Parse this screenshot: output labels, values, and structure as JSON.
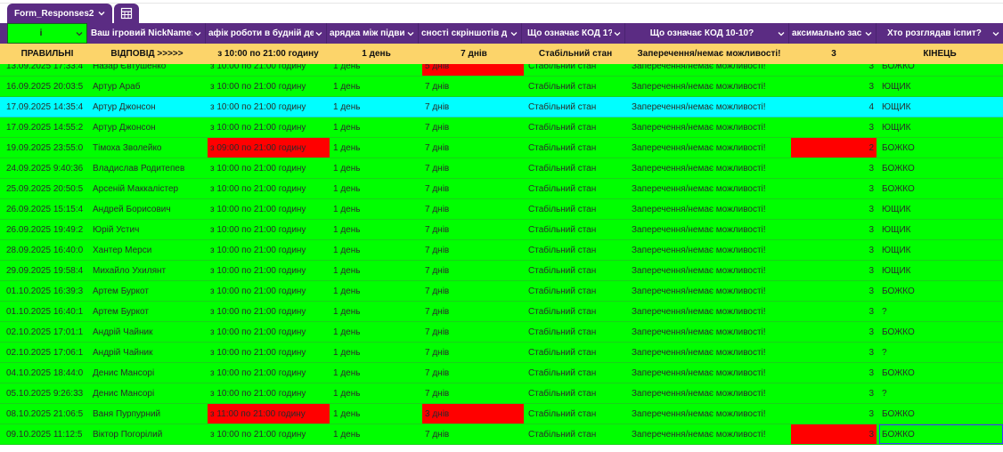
{
  "sheet_tab": {
    "label": "Form_Responses2"
  },
  "filter_header": {
    "first_cell": "і",
    "columns": [
      "Ваш ігровий NickName:",
      "афік роботи в будній ден",
      "арядка між підвищ",
      "сності скріншотів д",
      "Що означає КОД 1?",
      "Що означає КОД 10-10?",
      "аксимально зас",
      "Хто розглядав іспит?"
    ]
  },
  "answer_key": {
    "label_1": "ПРАВИЛЬНІ",
    "label_2": "ВІДПОВІД >>>>>",
    "schedule": "з 10:00 по 21:00 годину",
    "order": "1 день",
    "screens": "7 днів",
    "code1": "Стабільний стан",
    "code1010": "Заперечення/немає можливості!",
    "max": "3",
    "reviewer": "КІНЕЦЬ"
  },
  "rows": [
    {
      "ts": "13.09.2025 17:33:4",
      "nick": "Назар Євтушенко",
      "schedule": "з 10:00 по 21:00 годину",
      "order": "1 день",
      "screens": "5 днів",
      "code1": "Стабільний стан",
      "code1010": "Заперечення/немає можливості!",
      "max": "3",
      "reviewer": "БОЖКО",
      "red_screens": true
    },
    {
      "ts": "16.09.2025 20:03:5",
      "nick": "Артур Араб",
      "schedule": "з 10:00 по 21:00 годину",
      "order": "1 день",
      "screens": "7 днів",
      "code1": "Стабільний стан",
      "code1010": "Заперечення/немає можливості!",
      "max": "3",
      "reviewer": "ЮЩИК"
    },
    {
      "ts": "17.09.2025 14:35:4",
      "nick": "Артур Джонсон",
      "schedule": "з 10:00 по 21:00 годину",
      "order": "1 день",
      "screens": "7 днів",
      "code1": "Стабільний стан",
      "code1010": "Заперечення/немає можливості!",
      "max": "4",
      "reviewer": "ЮЩИК",
      "cyan": true
    },
    {
      "ts": "17.09.2025 14:55:2",
      "nick": "Артур Джонсон",
      "schedule": "з 10:00 по 21:00 годину",
      "order": "1 день",
      "screens": "7 днів",
      "code1": "Стабільний стан",
      "code1010": "Заперечення/немає можливості!",
      "max": "3",
      "reviewer": "ЮЩИК"
    },
    {
      "ts": "19.09.2025 23:55:0",
      "nick": "Тімоха Зволейко",
      "schedule": "з 09:00 по 21:00 годину",
      "order": "1 день",
      "screens": "7 днів",
      "code1": "Стабільний стан",
      "code1010": "Заперечення/немає можливості!",
      "max": "2",
      "reviewer": "БОЖКО",
      "red_schedule": true,
      "red_max": true
    },
    {
      "ts": "24.09.2025 9:40:36",
      "nick": "Владислав Родитепев",
      "schedule": "з 10:00 по 21:00 годину",
      "order": "1 день",
      "screens": "7 днів",
      "code1": "Стабільний стан",
      "code1010": "Заперечення/немає можливості!",
      "max": "3",
      "reviewer": "БОЖКО"
    },
    {
      "ts": "25.09.2025 20:50:5",
      "nick": "Арсеній Маккалістер",
      "schedule": "з 10:00 по 21:00 годину",
      "order": "1 день",
      "screens": "7 днів",
      "code1": "Стабільний стан",
      "code1010": "Заперечення/немає можливості!",
      "max": "3",
      "reviewer": "БОЖКО"
    },
    {
      "ts": "26.09.2025 15:15:4",
      "nick": "Андрей Борисович",
      "schedule": "з 10:00 по 21:00 годину",
      "order": "1 день",
      "screens": "7 днів",
      "code1": "Стабільний стан",
      "code1010": "Заперечення/немає можливості!",
      "max": "3",
      "reviewer": "ЮЩИК"
    },
    {
      "ts": "26.09.2025 19:49:2",
      "nick": "Юрій Устич",
      "schedule": "з 10:00 по 21:00 годину",
      "order": "1 день",
      "screens": "7 днів",
      "code1": "Стабільний стан",
      "code1010": "Заперечення/немає можливості!",
      "max": "3",
      "reviewer": "ЮЩИК"
    },
    {
      "ts": "28.09.2025 16:40:0",
      "nick": "Хантер Мерси",
      "schedule": "з 10:00 по 21:00 годину",
      "order": "1 день",
      "screens": "7 днів",
      "code1": "Стабільний стан",
      "code1010": "Заперечення/немає можливості!",
      "max": "3",
      "reviewer": "ЮЩИК"
    },
    {
      "ts": "29.09.2025 19:58:4",
      "nick": "Михайло Ухилянт",
      "schedule": "з 10:00 по 21:00 годину",
      "order": "1 день",
      "screens": "7 днів",
      "code1": "Стабільний стан",
      "code1010": "Заперечення/немає можливості!",
      "max": "3",
      "reviewer": "ЮЩИК"
    },
    {
      "ts": "01.10.2025 16:39:3",
      "nick": "Артем Буркот",
      "schedule": "з 10:00 по 21:00 годину",
      "order": "1 день",
      "screens": "7 днів",
      "code1": "Стабільний стан",
      "code1010": "Заперечення/немає можливості!",
      "max": "3",
      "reviewer": "БОЖКО"
    },
    {
      "ts": "01.10.2025 16:40:1",
      "nick": "Артем Буркот",
      "schedule": "з 10:00 по 21:00 годину",
      "order": "1 день",
      "screens": "7 днів",
      "code1": "Стабільний стан",
      "code1010": "Заперечення/немає можливості!",
      "max": "3",
      "reviewer": "?"
    },
    {
      "ts": "02.10.2025 17:01:1",
      "nick": "Андрій Чайник",
      "schedule": "з 10:00 по 21:00 годину",
      "order": "1 день",
      "screens": "7 днів",
      "code1": "Стабільний стан",
      "code1010": "Заперечення/немає можливості!",
      "max": "3",
      "reviewer": "БОЖКО"
    },
    {
      "ts": "02.10.2025 17:06:1",
      "nick": "Андрій Чайник",
      "schedule": "з 10:00 по 21:00 годину",
      "order": "1 день",
      "screens": "7 днів",
      "code1": "Стабільний стан",
      "code1010": "Заперечення/немає можливості!",
      "max": "3",
      "reviewer": "?"
    },
    {
      "ts": "04.10.2025 18:44:0",
      "nick": "Денис Мансорі",
      "schedule": "з 10:00 по 21:00 годину",
      "order": "1 день",
      "screens": "7 днів",
      "code1": "Стабільний стан",
      "code1010": "Заперечення/немає можливості!",
      "max": "3",
      "reviewer": "БОЖКО"
    },
    {
      "ts": "05.10.2025 9:26:33",
      "nick": "Денис Мансорі",
      "schedule": "з 10:00 по 21:00 годину",
      "order": "1 день",
      "screens": "7 днів",
      "code1": "Стабільний стан",
      "code1010": "Заперечення/немає можливості!",
      "max": "3",
      "reviewer": "?"
    },
    {
      "ts": "08.10.2025 21:06:5",
      "nick": "Ваня Пурпурний",
      "schedule": "з 11:00 по 21:00 годину",
      "order": "1 день",
      "screens": "3 днів",
      "code1": "Стабільний стан",
      "code1010": "Заперечення/немає можливості!",
      "max": "3",
      "reviewer": "БОЖКО",
      "red_schedule": true,
      "red_screens": true
    },
    {
      "ts": "09.10.2025 11:12:5",
      "nick": "Віктор Погорілий",
      "schedule": "з 10:00 по 21:00 годину",
      "order": "1 день",
      "screens": "7 днів",
      "code1": "Стабільний стан",
      "code1010": "Заперечення/немає можливості!",
      "max": "3",
      "reviewer": "БОЖКО",
      "red_max": true,
      "selected_reviewer": true
    }
  ],
  "colors": {
    "header_purple": "#5b2c83",
    "answer_row": "#fcd46a",
    "correct_green": "#00ff00",
    "highlight_cyan": "#00ffff",
    "wrong_red": "#ff0000"
  }
}
